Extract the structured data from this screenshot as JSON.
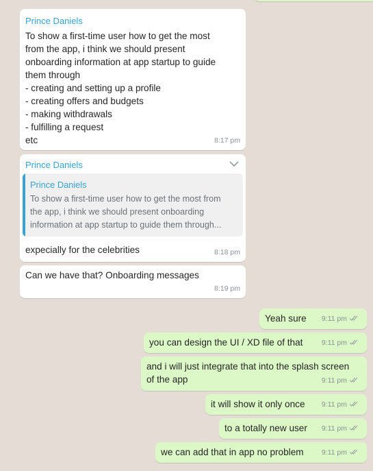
{
  "incoming": [
    {
      "sender": "Prince Daniels",
      "text": "To show a first-time user how to get the most\nfrom the app, i think we should present\nonboarding information at app startup to guide\nthem through\n- creating and setting up a profile\n- creating offers and budgets\n- making withdrawals\n- fulfilling a request\netc",
      "time": "8:17 pm"
    },
    {
      "sender": "Prince Daniels",
      "quote_sender": "Prince Daniels",
      "quote_text": "To show a first-time user how to get the most from\nthe app, i think we should present onboarding\ninformation at app startup to guide them through...",
      "text": "expecially for the celebrities",
      "time": "8:18 pm"
    },
    {
      "text": "Can we have that? Onboarding messages",
      "time": "8:19 pm"
    }
  ],
  "outgoing": [
    {
      "text": "Yeah sure",
      "time": "9:11 pm"
    },
    {
      "text": "you can design the UI / XD file of that",
      "time": "9:11 pm"
    },
    {
      "text": "and i will just integrate that into the splash screen\nof the app",
      "time": "9:11 pm"
    },
    {
      "text": "it will show it only once",
      "time": "9:11 pm"
    },
    {
      "text": "to a totally new user",
      "time": "9:11 pm"
    },
    {
      "text": "we can add that in app no problem",
      "time": "9:11 pm"
    }
  ],
  "icons": {
    "read_receipt": "double-check-icon",
    "message_menu": "chevron-down-icon"
  },
  "colors": {
    "background": "#e5ddd5",
    "incoming_bubble": "#ffffff",
    "outgoing_bubble": "#dcf8c6",
    "sender_name": "#35a3d3",
    "timestamp": "#8b9196"
  }
}
